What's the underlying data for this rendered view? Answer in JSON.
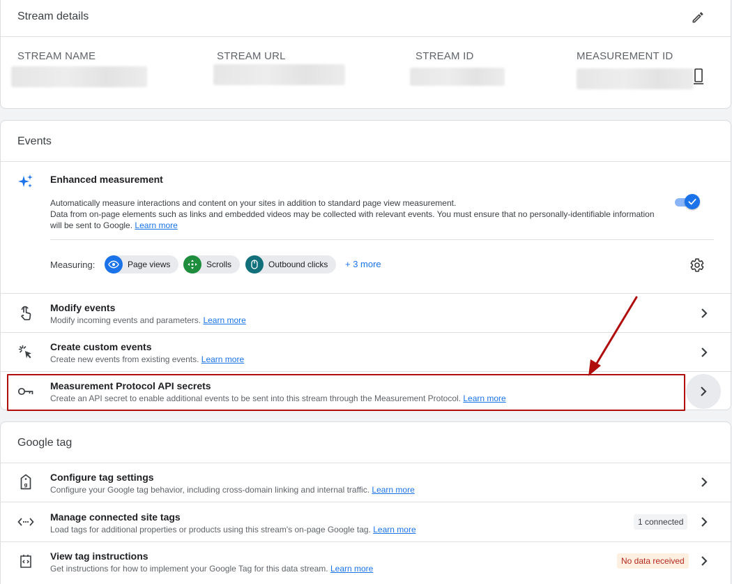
{
  "stream_details": {
    "title": "Stream details",
    "columns": [
      {
        "label": "STREAM NAME"
      },
      {
        "label": "STREAM URL"
      },
      {
        "label": "STREAM ID"
      },
      {
        "label": "MEASUREMENT ID"
      }
    ]
  },
  "events": {
    "title": "Events",
    "enhanced": {
      "title": "Enhanced measurement",
      "desc1": "Automatically measure interactions and content on your sites in addition to standard page view measurement.",
      "desc2": "Data from on-page elements such as links and embedded videos may be collected with relevant events. You must ensure that no personally-identifiable information will be sent to Google.",
      "learn_more": "Learn more",
      "toggle_on": true,
      "measuring_label": "Measuring:",
      "chips": [
        "Page views",
        "Scrolls",
        "Outbound clicks"
      ],
      "more": "+ 3 more"
    },
    "rows": [
      {
        "title": "Modify events",
        "sub": "Modify incoming events and parameters.",
        "link": "Learn more"
      },
      {
        "title": "Create custom events",
        "sub": "Create new events from existing events.",
        "link": "Learn more"
      },
      {
        "title": "Measurement Protocol API secrets",
        "sub": "Create an API secret to enable additional events to be sent into this stream through the Measurement Protocol.",
        "link": "Learn more"
      }
    ]
  },
  "google_tag": {
    "title": "Google tag",
    "rows": [
      {
        "title": "Configure tag settings",
        "sub": "Configure your Google tag behavior, including cross-domain linking and internal traffic.",
        "link": "Learn more"
      },
      {
        "title": "Manage connected site tags",
        "sub": "Load tags for additional properties or products using this stream's on-page Google tag.",
        "link": "Learn more",
        "badge": "1 connected"
      },
      {
        "title": "View tag instructions",
        "sub": "Get instructions for how to implement your Google Tag for this data stream.",
        "link": "Learn more",
        "badge": "No data received"
      }
    ]
  },
  "colors": {
    "accent": "#1a73e8",
    "highlight_border": "#b00d0d",
    "arrow": "#b00d0d",
    "warning_badge_bg": "#fef0e0",
    "warning_badge_text": "#b3261e"
  },
  "icons": {
    "edit": "pencil-icon",
    "copy": "copy-icon",
    "enhanced": "sparkle-icon",
    "settings": "gear-icon",
    "modify": "touch-icon",
    "custom": "cursor-click-icon",
    "secrets": "key-icon",
    "configure": "tag-icon",
    "connected": "code-arrows-icon",
    "instructions": "code-box-icon"
  }
}
